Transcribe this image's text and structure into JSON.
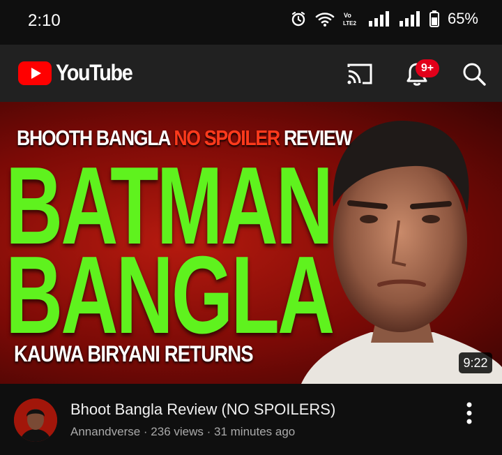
{
  "status_bar": {
    "time": "2:10",
    "battery": "65%",
    "icons": [
      "alarm-icon",
      "wifi-icon",
      "volte-icon",
      "signal-icon",
      "signal-icon",
      "battery-icon"
    ]
  },
  "app_bar": {
    "logo_text": "YouTube",
    "notification_badge": "9+",
    "icons": [
      "cast-icon",
      "bell-icon",
      "search-icon"
    ]
  },
  "video": {
    "thumbnail": {
      "kicker_part1": "BHOOTH BANGLA ",
      "kicker_part2": "NO SPOILER",
      "kicker_part3": " REVIEW",
      "line1": "BATMAN",
      "line2": "BANGLA",
      "subtitle": "KAUWA BIRYANI RETURNS"
    },
    "duration": "9:22",
    "title": "Bhoot Bangla Review (NO SPOILERS)",
    "meta": "Annandverse · 236 views · 31 minutes ago"
  },
  "colors": {
    "brand_red": "#ff0000",
    "thumbnail_green": "#5ff21e",
    "badge_red": "#e2001a",
    "background": "#0f0f0f"
  }
}
